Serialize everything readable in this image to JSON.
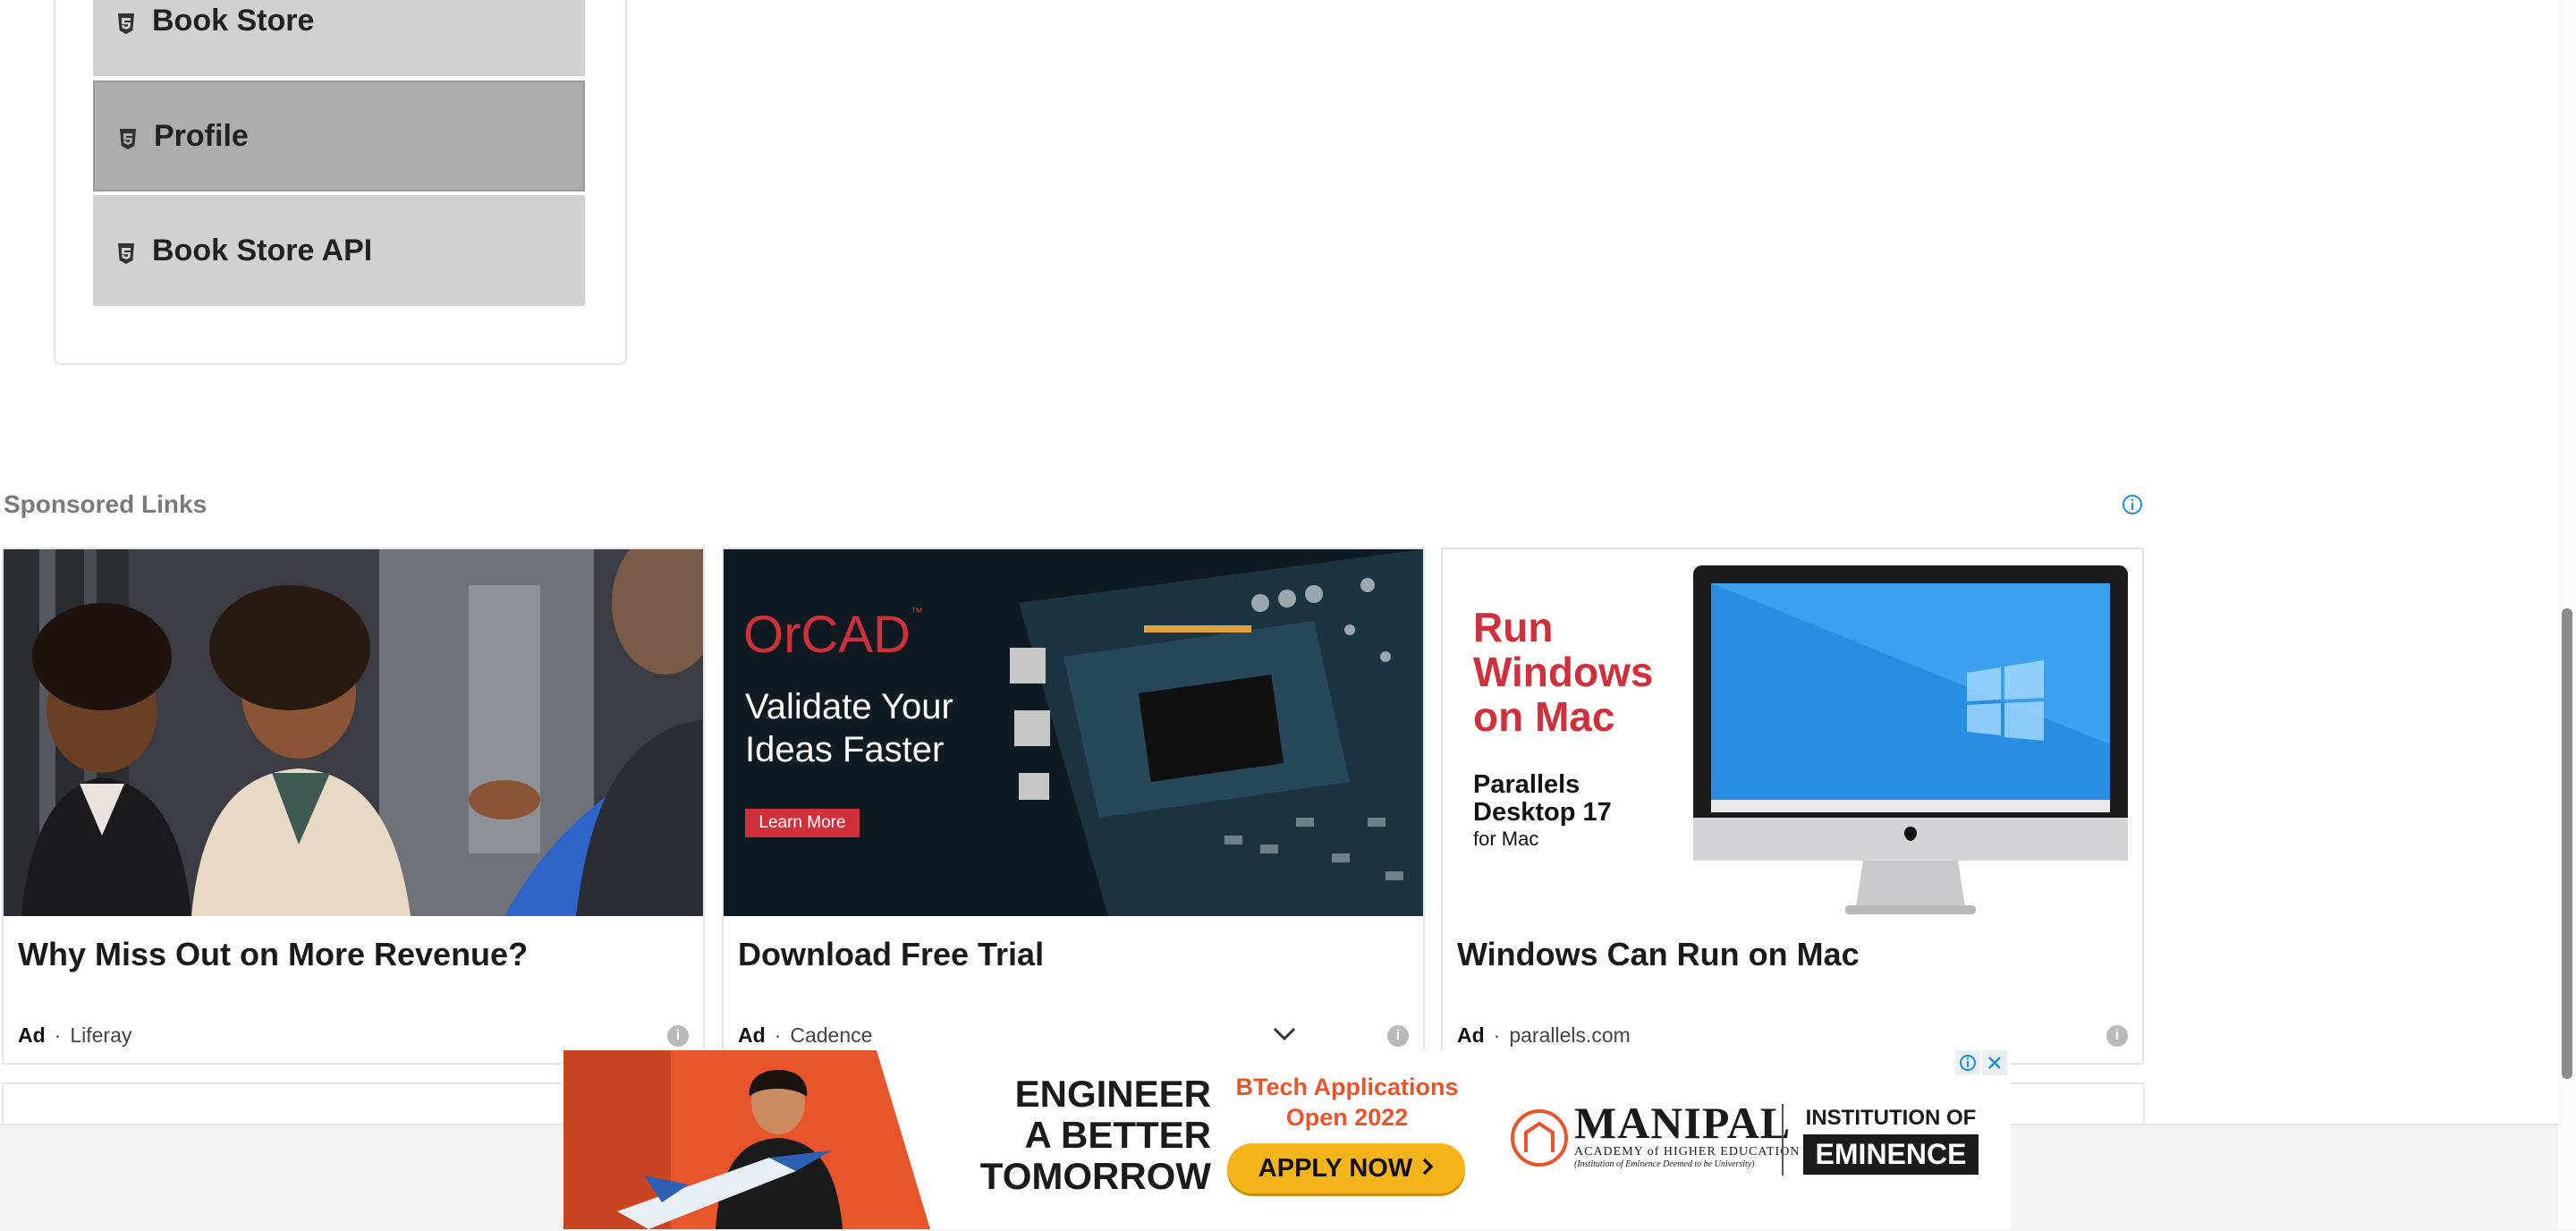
{
  "sidebar": {
    "items": [
      {
        "label": "Book Store",
        "active": false
      },
      {
        "label": "Profile",
        "active": true
      },
      {
        "label": "Book Store API",
        "active": false
      }
    ]
  },
  "sponsored": {
    "title": "Sponsored Links",
    "ads": [
      {
        "title": "Why Miss Out on More Revenue?",
        "ad_label": "Ad",
        "separator": "·",
        "source": "Liferay"
      },
      {
        "title": "Download Free Trial",
        "ad_label": "Ad",
        "separator": "·",
        "source": "Cadence",
        "image": {
          "brand": "OrCAD",
          "tm": "™",
          "headline_1": "Validate Your",
          "headline_2": "Ideas Faster",
          "cta": "Learn More"
        }
      },
      {
        "title": "Windows Can Run on Mac",
        "ad_label": "Ad",
        "separator": "·",
        "source": "parallels.com",
        "image": {
          "line1": "Run",
          "line2": "Windows",
          "line3": "on Mac",
          "product_1": "Parallels",
          "product_2": "Desktop 17",
          "product_3": "for Mac"
        }
      }
    ]
  },
  "banner": {
    "headline_1": "ENGINEER",
    "headline_2": "A BETTER",
    "headline_3": "TOMORROW",
    "apps_1": "BTech Applications",
    "apps_2": "Open 2022",
    "cta": "APPLY NOW",
    "brand": "MANIPAL",
    "brand_sub": "ACADEMY of HIGHER EDUCATION",
    "brand_tagline": "(Institution of Eminence Deemed to be University)",
    "ioe_1": "INSTITUTION OF",
    "ioe_2": "EMINENCE"
  },
  "colors": {
    "menu_bg": "#d1d1d1",
    "menu_active_bg": "#adadad",
    "ad_red": "#d0303c",
    "info_blue": "#1a8fd1",
    "banner_orange": "#e8552b",
    "apply_yellow": "#f4b41a"
  }
}
